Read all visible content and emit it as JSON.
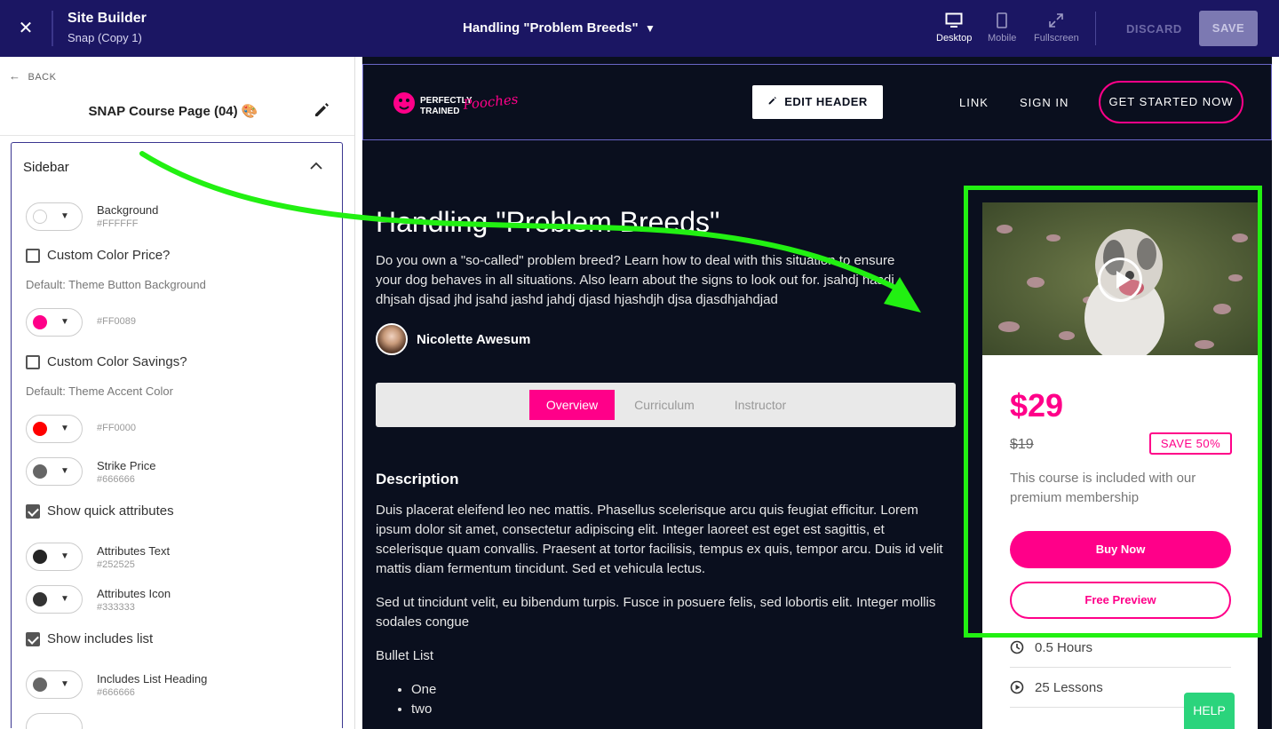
{
  "topbar": {
    "title": "Site Builder",
    "subtitle": "Snap (Copy 1)",
    "page_title": "Handling \"Problem Breeds\"",
    "views": [
      {
        "label": "Desktop",
        "icon": "desktop-icon",
        "active": true
      },
      {
        "label": "Mobile",
        "icon": "mobile-icon",
        "active": false
      },
      {
        "label": "Fullscreen",
        "icon": "fullscreen-icon",
        "active": false
      }
    ],
    "discard_label": "DISCARD",
    "save_label": "SAVE",
    "bg_color": "#1b1663"
  },
  "left_panel": {
    "back_label": "BACK",
    "page_name": "SNAP Course Page (04) 🎨",
    "section_title": "Sidebar",
    "background": {
      "label": "Background",
      "hex": "#FFFFFF"
    },
    "custom_color_price": {
      "label": "Custom Color Price?",
      "checked": false
    },
    "price_default_text": "Default: Theme Button Background",
    "price_color": {
      "hex": "#FF0089"
    },
    "custom_color_savings": {
      "label": "Custom Color Savings?",
      "checked": false
    },
    "savings_default_text": "Default: Theme Accent Color",
    "savings_color": {
      "hex": "#FF0000"
    },
    "strike_price": {
      "label": "Strike Price",
      "hex": "#666666"
    },
    "show_quick_attributes": {
      "label": "Show quick attributes",
      "checked": true
    },
    "attributes_text": {
      "label": "Attributes Text",
      "hex": "#252525"
    },
    "attributes_icon": {
      "label": "Attributes Icon",
      "hex": "#333333"
    },
    "show_includes_list": {
      "label": "Show includes list",
      "checked": true
    },
    "includes_list_heading": {
      "label": "Includes List Heading",
      "hex": "#666666"
    }
  },
  "preview": {
    "logo_top": "PERFECTLY",
    "logo_bottom": "TRAINED",
    "logo_script": "Pooches",
    "edit_header_label": "EDIT HEADER",
    "nav": {
      "link": "LINK",
      "sign_in": "SIGN IN",
      "cta": "GET STARTED NOW"
    },
    "course_title": "Handling \"Problem Breeds\"",
    "course_description": "Do you own a \"so-called\" problem breed? Learn how to deal with this situation to ensure your dog behaves in all situations. Also learn about the signs to look out for. jsahdj hasdj dhjsah djsad jhd jsahd jashd jahdj djasd hjashdjh djsa djasdhjahdjad",
    "author": "Nicolette Awesum",
    "tabs": [
      "Overview",
      "Curriculum",
      "Instructor"
    ],
    "description_heading": "Description",
    "paragraph1": "Duis placerat eleifend leo nec mattis. Phasellus scelerisque arcu quis feugiat efficitur. Lorem ipsum dolor sit amet, consectetur adipiscing elit. Integer laoreet est eget est sagittis, et scelerisque quam convallis. Praesent at tortor facilisis, tempus ex quis, tempor arcu. Duis id velit mattis diam fermentum tincidunt. Sed et vehicula lectus.",
    "paragraph2": "Sed ut tincidunt velit, eu bibendum turpis. Fusce in posuere felis, sed lobortis elit. Integer mollis sodales congue",
    "bullet_heading": "Bullet List",
    "bullets": [
      "One",
      "two"
    ],
    "accent": "#ff0089",
    "bg_color": "#0a0f1e"
  },
  "product": {
    "price": "$29",
    "strike_price": "$19",
    "save_badge": "SAVE 50%",
    "included_text": "This course is included with our premium membership",
    "buy_label": "Buy Now",
    "preview_label": "Free Preview",
    "attributes": [
      {
        "icon": "clock-icon",
        "text": "0.5 Hours"
      },
      {
        "icon": "play-circle-icon",
        "text": "25 Lessons"
      }
    ]
  },
  "help_label": "HELP",
  "annotation_color": "#22f012"
}
